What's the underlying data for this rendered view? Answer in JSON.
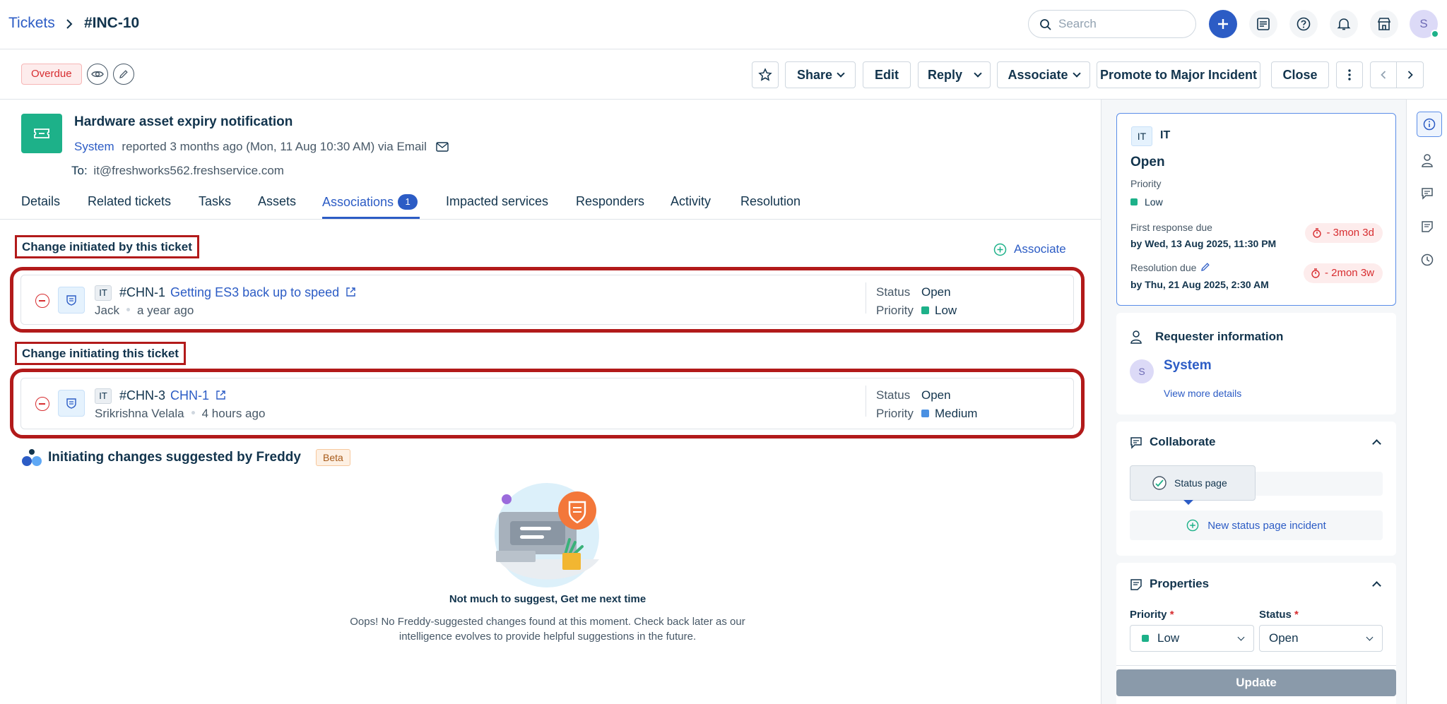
{
  "breadcrumb": {
    "parent": "Tickets",
    "current": "#INC-10"
  },
  "header": {
    "search_placeholder": "Search",
    "avatar_initial": "S"
  },
  "toolbar": {
    "status_badge": "Overdue",
    "share_label": "Share",
    "edit_label": "Edit",
    "reply_label": "Reply",
    "associate_label": "Associate",
    "promote_label": "Promote to Major Incident",
    "close_label": "Close"
  },
  "ticket": {
    "title": "Hardware asset expiry notification",
    "reporter": "System",
    "reported_text": "reported 3 months ago (Mon, 11 Aug 10:30 AM) via Email",
    "to_label": "To:",
    "to_email": "it@freshworks562.freshservice.com"
  },
  "tabs": [
    {
      "label": "Details"
    },
    {
      "label": "Related tickets"
    },
    {
      "label": "Tasks"
    },
    {
      "label": "Assets"
    },
    {
      "label": "Associations",
      "badge": "1"
    },
    {
      "label": "Impacted services"
    },
    {
      "label": "Responders"
    },
    {
      "label": "Activity"
    },
    {
      "label": "Resolution"
    }
  ],
  "associations": {
    "associate_link": "Associate",
    "initiated_by": {
      "label": "Change initiated by this ticket",
      "item": {
        "workspace": "IT",
        "id": "#CHN-1",
        "title": "Getting ES3 back up to speed",
        "owner": "Jack",
        "time": "a year ago",
        "status_label": "Status",
        "status": "Open",
        "priority_label": "Priority",
        "priority": "Low",
        "priority_color": "#1db189"
      }
    },
    "initiating": {
      "label": "Change initiating this ticket",
      "item": {
        "workspace": "IT",
        "id": "#CHN-3",
        "title": "CHN-1",
        "owner": "Srikrishna Velala",
        "time": "4 hours ago",
        "status_label": "Status",
        "status": "Open",
        "priority_label": "Priority",
        "priority": "Medium",
        "priority_color": "#4a90e2"
      }
    }
  },
  "freddy": {
    "title": "Initiating changes suggested by Freddy",
    "badge": "Beta",
    "empty_title": "Not much to suggest, Get me next time",
    "empty_text": "Oops! No Freddy-suggested changes found at this moment. Check back later as our intelligence evolves to provide helpful suggestions in the future."
  },
  "sidebar": {
    "status_card": {
      "workspace_badge": "IT",
      "workspace": "IT",
      "status": "Open",
      "priority_label": "Priority",
      "priority": "Low",
      "first_response_label": "First response due",
      "first_response_date": "by Wed, 13 Aug 2025, 11:30 PM",
      "first_response_overdue": "- 3mon 3d",
      "resolution_label": "Resolution due",
      "resolution_date": "by Thu, 21 Aug 2025, 2:30 AM",
      "resolution_overdue": "- 2mon 3w"
    },
    "requester": {
      "title": "Requester information",
      "avatar_initial": "S",
      "name": "System",
      "more_link": "View more details"
    },
    "collaborate": {
      "title": "Collaborate",
      "status_page_label": "Status page",
      "new_incident_label": "New status page incident"
    },
    "properties": {
      "title": "Properties",
      "priority_label": "Priority",
      "priority_value": "Low",
      "status_label": "Status",
      "status_value": "Open",
      "required_mark": "*",
      "update_label": "Update"
    }
  },
  "colors": {
    "brand": "#2c5cc5",
    "highlight_border": "#b21a1a",
    "overdue": "#d72d30",
    "low_priority": "#1db189",
    "medium_priority": "#4a90e2"
  }
}
